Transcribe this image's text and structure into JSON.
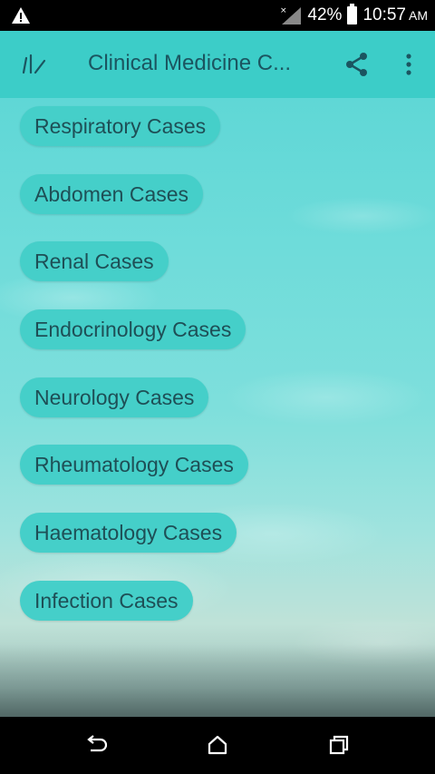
{
  "status_bar": {
    "battery": "42%",
    "time": "10:57",
    "ampm": "AM"
  },
  "app_bar": {
    "title": "Clinical Medicine C..."
  },
  "cases": [
    "Respiratory Cases",
    "Abdomen Cases",
    "Renal Cases",
    "Endocrinology Cases",
    "Neurology Cases",
    "Rheumatology Cases",
    "Haematology Cases",
    "Infection Cases"
  ],
  "colors": {
    "app_bar": "#3ccdc8",
    "button": "#45cfc9",
    "text": "#1e4f56"
  }
}
